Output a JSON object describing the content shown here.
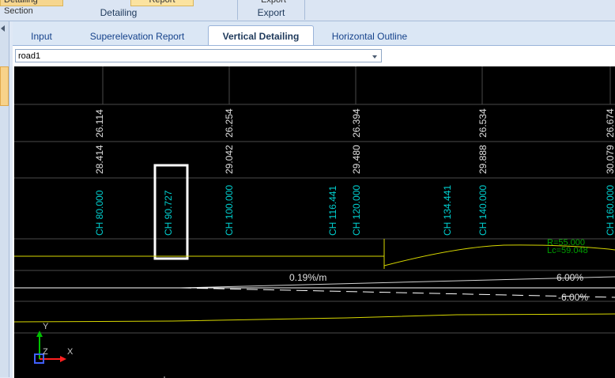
{
  "ribbon": {
    "groups": [
      {
        "label": "Detailing",
        "button": "Detailing Section"
      },
      {
        "label": "Export",
        "button": "Export"
      }
    ],
    "report_button": "Report"
  },
  "tabs": [
    {
      "label": "Input"
    },
    {
      "label": "Superelevation Report"
    },
    {
      "label": "Vertical Detailing",
      "active": true
    },
    {
      "label": "Horizontal Outline"
    }
  ],
  "road_select": {
    "value": "road1"
  },
  "drawing": {
    "columns": [
      {
        "chainage": "CH 80.000",
        "level_top": "26.114",
        "level_mid": "28.414"
      },
      {
        "chainage": "CH 90.727"
      },
      {
        "chainage": "CH 100.000",
        "level_top": "26.254",
        "level_mid": "29.042"
      },
      {
        "chainage": "CH 116.441"
      },
      {
        "chainage": "CH 120.000",
        "level_top": "26.394",
        "level_mid": "29.480"
      },
      {
        "chainage": "CH 134.441"
      },
      {
        "chainage": "CH 140.000",
        "level_top": "26.534",
        "level_mid": "29.888"
      },
      {
        "chainage": "CH 160.000",
        "level_top": "26.674",
        "level_mid": "30.079"
      }
    ],
    "curve_label_r": "R=55.000",
    "curve_label_lc": "Lc=59.048",
    "grade_label": "0.19%/m",
    "superelevation_top": "6.00%",
    "superelevation_bottom": "-6.00%",
    "axis_y": "Y",
    "axis_z": "Z",
    "axis_x": "X",
    "colors": {
      "background": "#000000",
      "chainage_text": "#00d0d0",
      "level_text": "#e0e0e0",
      "alignment_line": "#d8d800",
      "curve_text": "#00a000",
      "highlight": "#ffffff"
    }
  }
}
